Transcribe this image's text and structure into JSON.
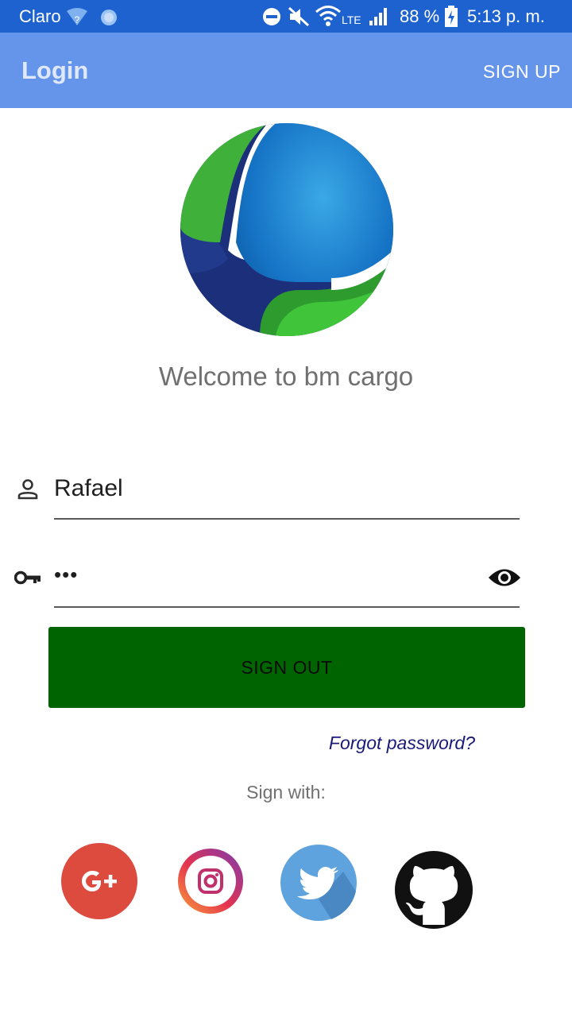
{
  "status_bar": {
    "carrier": "Claro",
    "network_label": "LTE",
    "battery": "88 %",
    "time": "5:13 p. m."
  },
  "app_bar": {
    "title": "Login",
    "signup_label": "SIGN UP"
  },
  "welcome_text": "Welcome to bm cargo",
  "form": {
    "username_value": "Rafael",
    "password_value": "•••"
  },
  "sign_out_label": "SIGN OUT",
  "forgot_password_label": "Forgot password?",
  "sign_with_label": "Sign with:",
  "colors": {
    "status_bar": "#1d62cf",
    "app_bar": "#6595eb",
    "button": "#006400",
    "link": "#1a1a7a"
  },
  "social": [
    {
      "icon": "google-plus-icon"
    },
    {
      "icon": "instagram-icon"
    },
    {
      "icon": "twitter-icon"
    },
    {
      "icon": "github-icon"
    }
  ]
}
